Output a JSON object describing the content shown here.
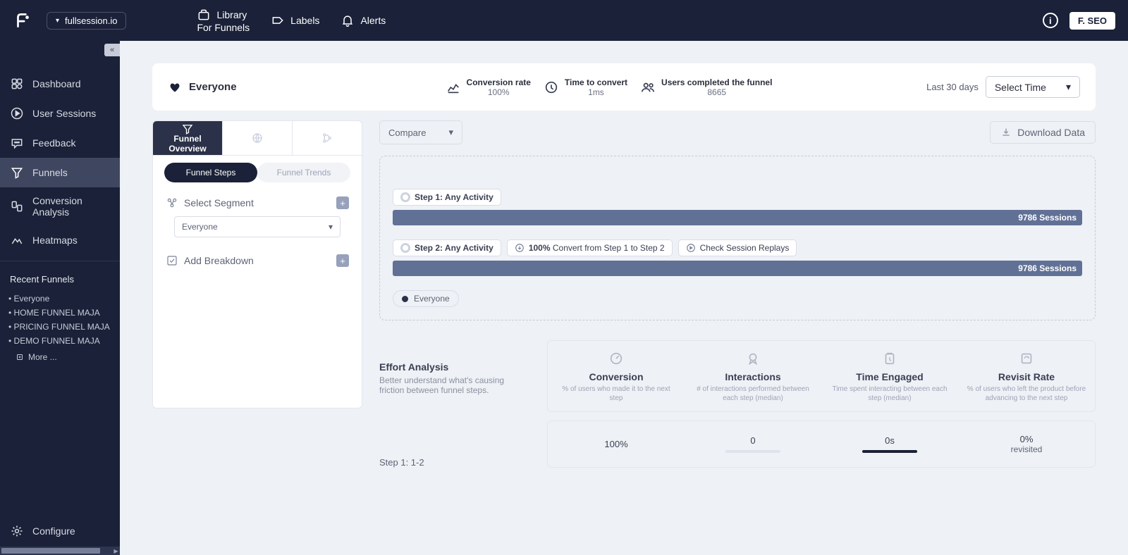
{
  "workspace": "fullsession.io",
  "topnav": {
    "library": "Library",
    "library_sub": "For Funnels",
    "labels": "Labels",
    "alerts": "Alerts"
  },
  "user": "F. SEO",
  "sidebar": {
    "dashboard": "Dashboard",
    "user_sessions": "User Sessions",
    "feedback": "Feedback",
    "funnels": "Funnels",
    "conversion_analysis": "Conversion Analysis",
    "heatmaps": "Heatmaps",
    "recent_header": "Recent Funnels",
    "recent": [
      "Everyone",
      "HOME FUNNEL MAJA",
      "PRICING FUNNEL MAJA",
      "DEMO FUNNEL MAJA"
    ],
    "more": "More ...",
    "configure": "Configure"
  },
  "header": {
    "audience": "Everyone",
    "conversion_rate_lbl": "Conversion rate",
    "conversion_rate_val": "100%",
    "time_to_convert_lbl": "Time to convert",
    "time_to_convert_val": "1ms",
    "completed_lbl": "Users completed the funnel",
    "completed_val": "8665",
    "date_range": "Last 30 days",
    "select_time": "Select Time"
  },
  "tabs": {
    "overview_l1": "Funnel",
    "overview_l2": "Overview"
  },
  "subtabs": {
    "steps": "Funnel Steps",
    "trends": "Funnel Trends"
  },
  "segment": {
    "select": "Select Segment",
    "value": "Everyone",
    "add_breakdown": "Add Breakdown"
  },
  "actions": {
    "compare": "Compare",
    "download": "Download Data"
  },
  "steps": {
    "s1_label": "Step 1: Any Activity",
    "s1_sessions": "9786 Sessions",
    "s2_label": "Step 2: Any Activity",
    "s2_conv_pct": "100%",
    "s2_conv_txt": " Convert from Step 1 to Step 2",
    "s2_replay": "Check Session Replays",
    "s2_sessions": "9786 Sessions",
    "legend": "Everyone"
  },
  "effort": {
    "title": "Effort Analysis",
    "desc": "Better understand what's causing friction between funnel steps.",
    "cols": [
      {
        "title": "Conversion",
        "desc": "% of users who made it to the next step"
      },
      {
        "title": "Interactions",
        "desc": "# of interactions performed between each step (median)"
      },
      {
        "title": "Time Engaged",
        "desc": "Time spent interacting between each step (median)"
      },
      {
        "title": "Revisit Rate",
        "desc": "% of users who left the product before advancing to the next step"
      }
    ],
    "step_row_label": "Step 1: 1-2",
    "values": {
      "conversion": "100%",
      "interactions": "0",
      "time_engaged": "0s",
      "revisit_pct": "0%",
      "revisit_txt": "revisited"
    }
  },
  "chart_data": {
    "type": "bar",
    "title": "Funnel Steps",
    "categories": [
      "Step 1: Any Activity",
      "Step 2: Any Activity"
    ],
    "series": [
      {
        "name": "Everyone",
        "values": [
          9786,
          9786
        ]
      }
    ],
    "xlabel": "Step",
    "ylabel": "Sessions",
    "ylim": [
      0,
      9786
    ]
  }
}
